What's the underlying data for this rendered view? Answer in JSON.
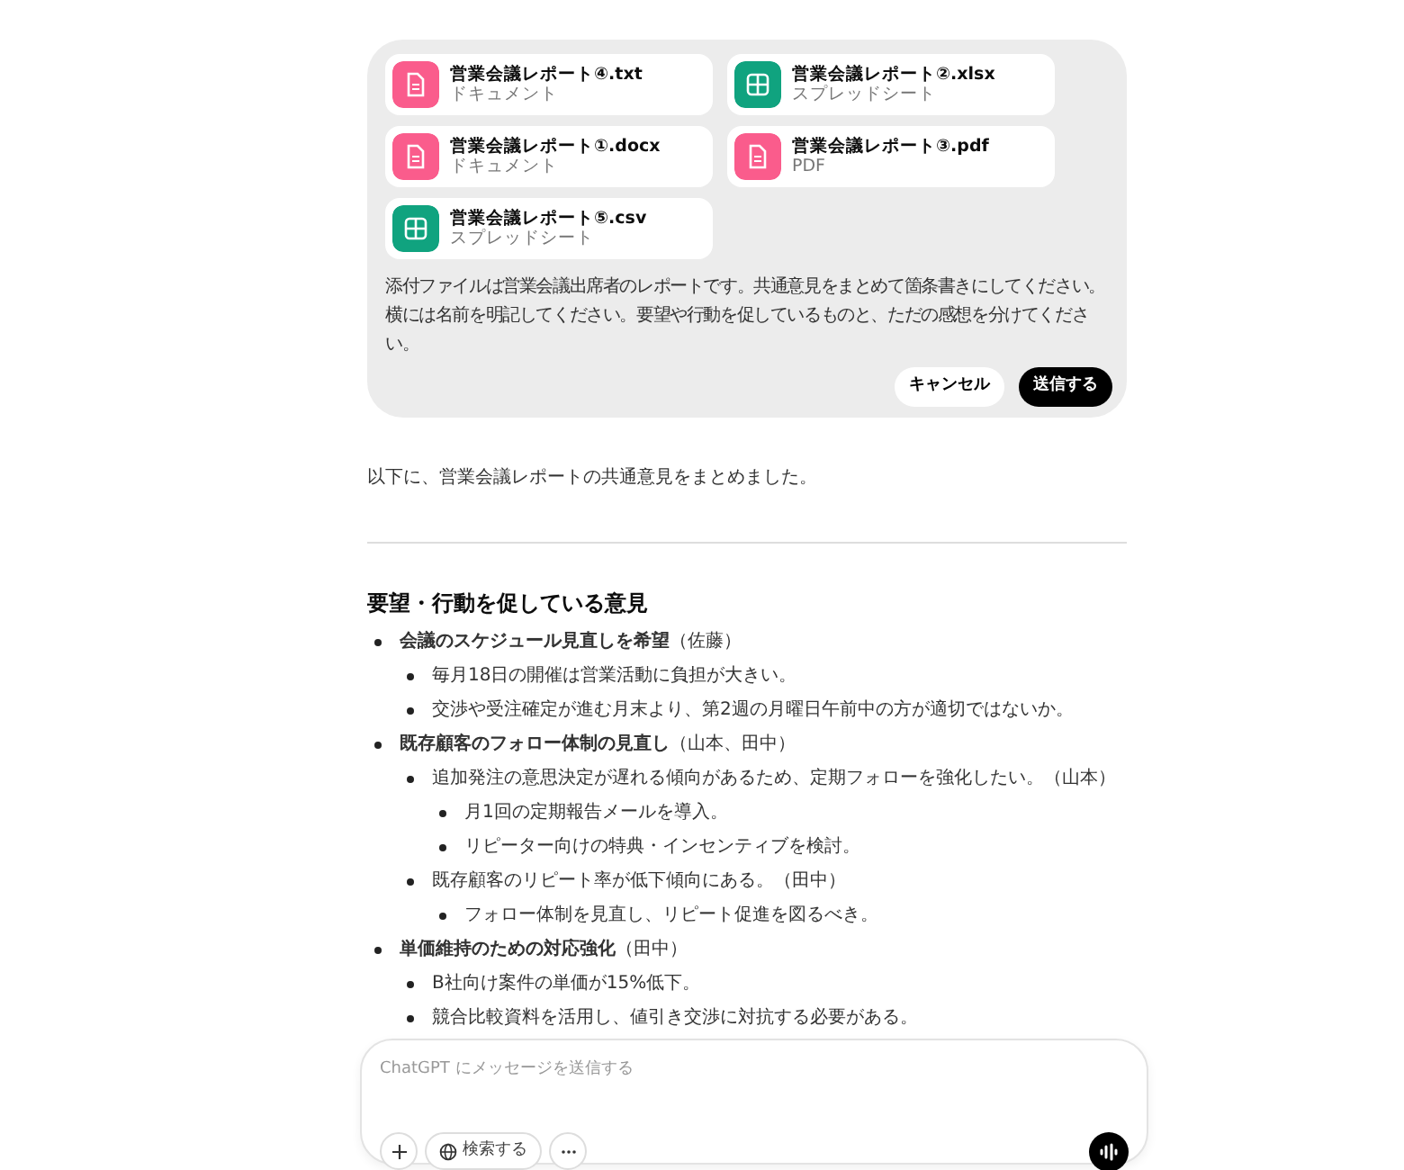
{
  "edit_message": {
    "attachments": [
      {
        "name": "営業会議レポート④.txt",
        "type_label": "ドキュメント",
        "kind": "doc",
        "color": "#fa5c8c"
      },
      {
        "name": "営業会議レポート②.xlsx",
        "type_label": "スプレッドシート",
        "kind": "sheet",
        "color": "#10a37f"
      },
      {
        "name": "営業会議レポート①.docx",
        "type_label": "ドキュメント",
        "kind": "doc",
        "color": "#fa5c8c"
      },
      {
        "name": "営業会議レポート③.pdf",
        "type_label": "PDF",
        "kind": "doc",
        "color": "#fa5c8c"
      },
      {
        "name": "営業会議レポート⑤.csv",
        "type_label": "スプレッドシート",
        "kind": "sheet",
        "color": "#10a37f"
      }
    ],
    "text": "添付ファイルは営業会議出席者のレポートです。共通意見をまとめて箇条書きにしてください。横には名前を明記してください。要望や行動を促しているものと、ただの感想を分けてください。",
    "cancel": "キャンセル",
    "send": "送信する"
  },
  "response": {
    "intro": "以下に、営業会議レポートの共通意見をまとめました。",
    "heading": "要望・行動を促している意見",
    "items": [
      {
        "text": "**会議のスケジュール見直しを希望**（佐藤）",
        "children": [
          {
            "text": "毎月18日の開催は営業活動に負担が大きい。"
          },
          {
            "text": "交渉や受注確定が進む月末より、第2週の月曜日午前中の方が適切ではないか。"
          }
        ]
      },
      {
        "text": "**既存顧客のフォロー体制の見直し**（山本、田中）",
        "children": [
          {
            "text": "追加発注の意思決定が遅れる傾向があるため、定期フォローを強化したい。（山本）",
            "children": [
              {
                "text": "月1回の定期報告メールを導入。"
              },
              {
                "text": "リピーター向けの特典・インセンティブを検討。"
              }
            ]
          },
          {
            "text": "既存顧客のリピート率が低下傾向にある。（田中）",
            "children": [
              {
                "text": "フォロー体制を見直し、リピート促進を図るべき。"
              }
            ]
          }
        ]
      },
      {
        "text": "**単価維持のための対応強化**（田中）",
        "children": [
          {
            "text": "B社向け案件の単価が15%低下。"
          },
          {
            "text": "競合比較資料を活用し、値引き交渉に対抗する必要がある。"
          }
        ]
      }
    ]
  },
  "composer": {
    "placeholder": "ChatGPT にメッセージを送信する",
    "search": "検索する"
  }
}
